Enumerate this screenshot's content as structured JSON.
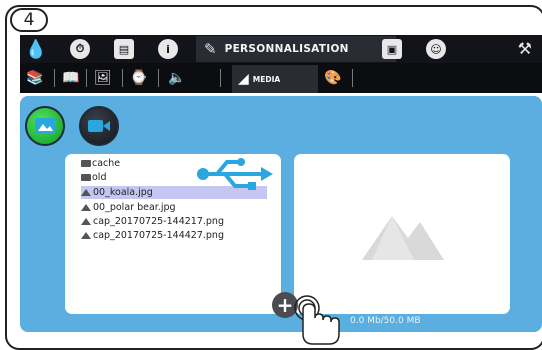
{
  "step": {
    "number": "4"
  },
  "topbar": {
    "active_tab_label": "PERSONNALISATION",
    "icons": [
      "drop-icon",
      "clock-icon",
      "book-icon",
      "info-icon",
      "pen-icon",
      "monitor-icon",
      "user-icon",
      "key-icon"
    ]
  },
  "subbar": {
    "active_label": "MEDIA",
    "icons": [
      "books-icon",
      "book-icon",
      "image-frame-icon",
      "clock-frame-icon",
      "speaker-icon",
      "media-icon",
      "palette-icon"
    ]
  },
  "media_buttons": {
    "image": "image-icon",
    "video": "video-camera-icon"
  },
  "files": [
    {
      "name": "cache",
      "type": "folder"
    },
    {
      "name": "old",
      "type": "folder"
    },
    {
      "name": "00_koala.jpg",
      "type": "image",
      "selected": true
    },
    {
      "name": "00_polar bear.jpg",
      "type": "image"
    },
    {
      "name": "cap_20170725-144217.png",
      "type": "image"
    },
    {
      "name": "cap_20170725-144427.png",
      "type": "image"
    }
  ],
  "storage": "0.0 Mb/50.0 MB",
  "colors": {
    "panel": "#5aaee0",
    "usb": "#2aa7df",
    "selection": "#c5c7f2"
  }
}
